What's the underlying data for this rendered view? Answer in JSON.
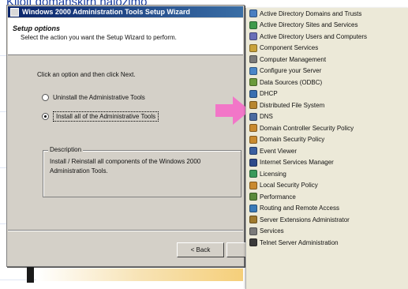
{
  "caption": "Kliolf dománskirh halozimo",
  "wizard": {
    "title": "Windows 2000 Administration Tools Setup Wizard",
    "header_title": "Setup options",
    "header_subtitle": "Select the action you want the Setup Wizard to perform.",
    "instruction": "Click an option and then click Next.",
    "options": [
      {
        "label": "Uninstall the Administrative Tools",
        "selected": false
      },
      {
        "label": "Install all of the Administrative Tools",
        "selected": true
      }
    ],
    "description_label": "Description",
    "description_text": "Install / Reinstall all components of the Windows 2000 Administration Tools.",
    "back_label": "< Back",
    "next_label": ""
  },
  "tools": [
    {
      "label": "Active Directory Domains and Trusts",
      "icon": "domains-icon",
      "color": "#4a7fc1"
    },
    {
      "label": "Active Directory Sites and Services",
      "icon": "sites-icon",
      "color": "#3f9a4a"
    },
    {
      "label": "Active Directory Users and Computers",
      "icon": "users-icon",
      "color": "#6a6fb8"
    },
    {
      "label": "Component Services",
      "icon": "component-icon",
      "color": "#c9a23a"
    },
    {
      "label": "Computer Management",
      "icon": "computer-icon",
      "color": "#7a7a7a"
    },
    {
      "label": "Configure your Server",
      "icon": "configure-icon",
      "color": "#4a86c8"
    },
    {
      "label": "Data Sources (ODBC)",
      "icon": "database-icon",
      "color": "#6a9a3a"
    },
    {
      "label": "DHCP",
      "icon": "dhcp-icon",
      "color": "#3a6fb0"
    },
    {
      "label": "Distributed File System",
      "icon": "dfs-icon",
      "color": "#b8862e"
    },
    {
      "label": "DNS",
      "icon": "dns-icon",
      "color": "#4a6aa0"
    },
    {
      "label": "Domain Controller Security Policy",
      "icon": "dc-policy-icon",
      "color": "#c98a2e"
    },
    {
      "label": "Domain Security Policy",
      "icon": "domain-policy-icon",
      "color": "#c98a2e"
    },
    {
      "label": "Event Viewer",
      "icon": "event-viewer-icon",
      "color": "#3a5fa0"
    },
    {
      "label": "Internet Services Manager",
      "icon": "iis-icon",
      "color": "#2e4a8a"
    },
    {
      "label": "Licensing",
      "icon": "licensing-icon",
      "color": "#3a9a5a"
    },
    {
      "label": "Local Security Policy",
      "icon": "local-policy-icon",
      "color": "#c98a2e"
    },
    {
      "label": "Performance",
      "icon": "performance-icon",
      "color": "#5a8a3a"
    },
    {
      "label": "Routing and Remote Access",
      "icon": "routing-icon",
      "color": "#3a7ab8"
    },
    {
      "label": "Server Extensions Administrator",
      "icon": "extensions-icon",
      "color": "#a07a2e"
    },
    {
      "label": "Services",
      "icon": "services-icon",
      "color": "#7a7a7a"
    },
    {
      "label": "Telnet Server Administration",
      "icon": "telnet-icon",
      "color": "#3a3a3a"
    }
  ],
  "colors": {
    "arrow": "#f276c8",
    "title_bar": "#0a246a",
    "dialog": "#d4d0c8"
  }
}
